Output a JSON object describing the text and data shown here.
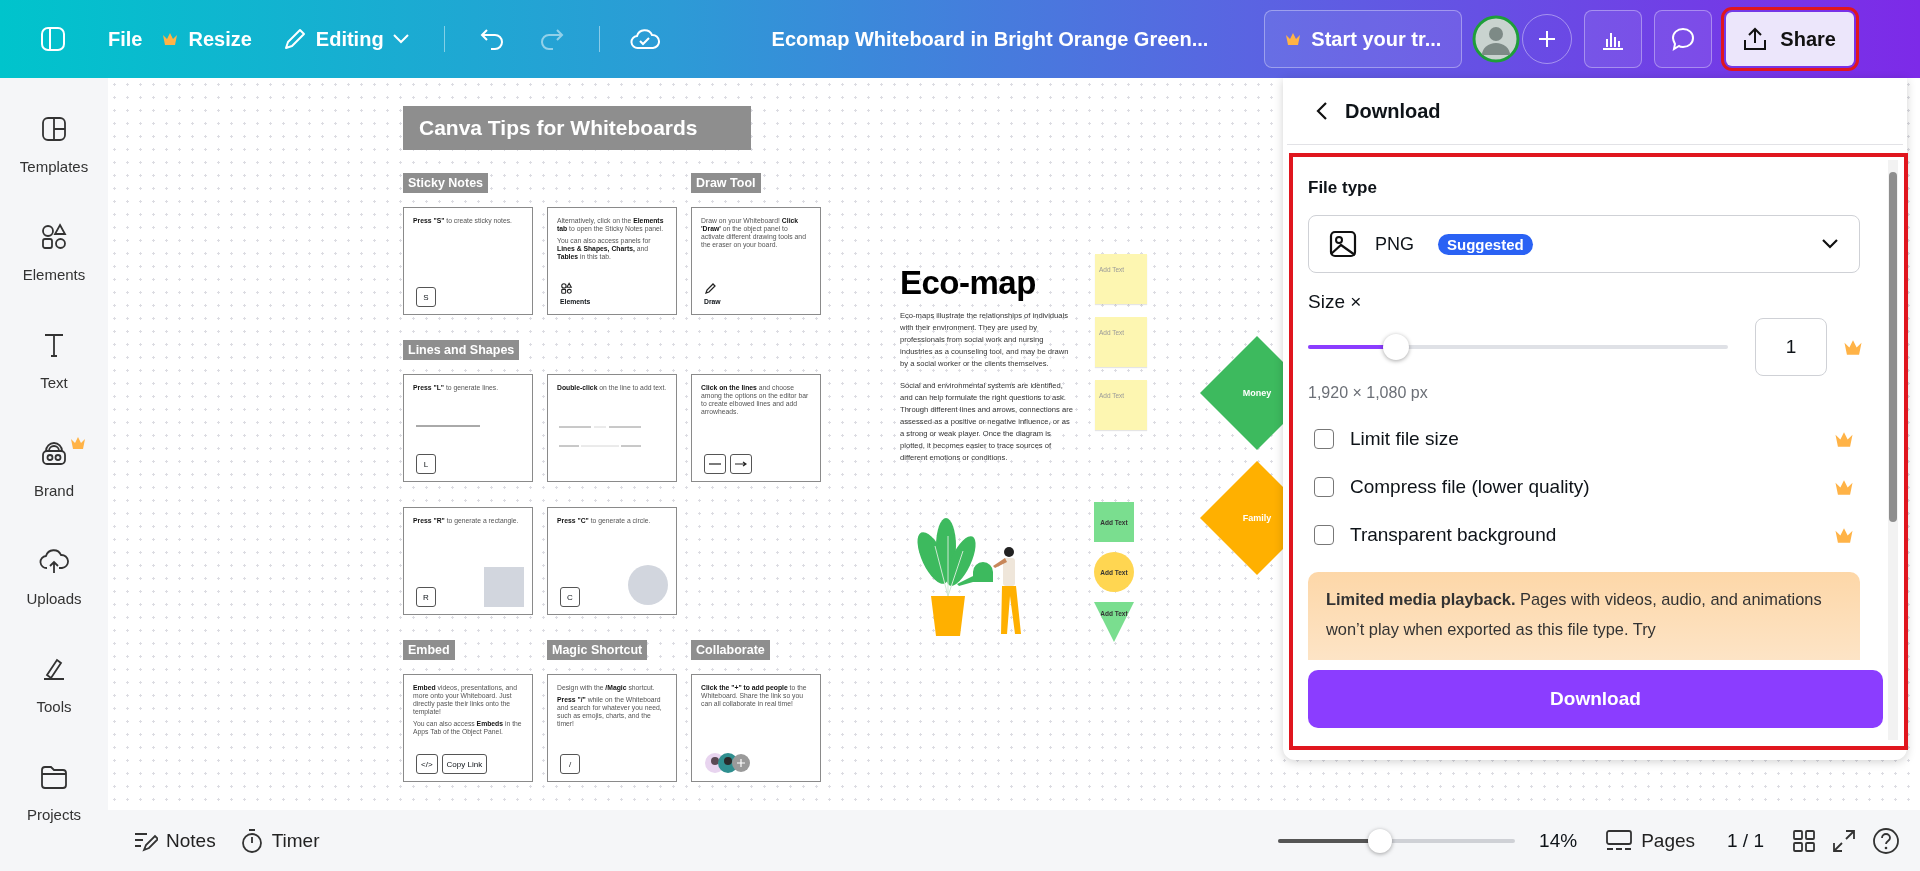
{
  "topbar": {
    "file": "File",
    "resize": "Resize",
    "mode": "Editing",
    "title": "Ecomap Whiteboard in Bright Orange Green...",
    "trial": "Start your tr...",
    "share": {
      "label": "Share",
      "highlighted": true
    }
  },
  "sidebar": [
    {
      "label": "Templates",
      "premium": false
    },
    {
      "label": "Elements",
      "premium": false
    },
    {
      "label": "Text",
      "premium": false
    },
    {
      "label": "Brand",
      "premium": true
    },
    {
      "label": "Uploads",
      "premium": false
    },
    {
      "label": "Tools",
      "premium": false
    },
    {
      "label": "Projects",
      "premium": false
    }
  ],
  "board": {
    "title": "Canva Tips for Whiteboards",
    "rows": [
      {
        "cards": [
          {
            "heading": "Sticky Notes",
            "kind": "keys",
            "paragraphs": [
              "**Press \"S\"** to create sticky notes."
            ],
            "keys": [
              "S"
            ]
          },
          {
            "kind": "elements",
            "paragraphs": [
              "Alternatively, click on the **Elements tab** to open the Sticky Notes panel.",
              "You can also access panels for **Lines & Shapes, Charts,** and **Tables** in this tab."
            ],
            "caption": "Elements"
          },
          {
            "heading": "Draw Tool",
            "kind": "draw",
            "paragraphs": [
              "Draw on your Whiteboard! **Click 'Draw'** on the object panel to activate different drawing tools and the eraser on your board."
            ],
            "caption": "Draw"
          }
        ]
      },
      {
        "cards": [
          {
            "heading": "Lines and Shapes",
            "kind": "line",
            "paragraphs": [
              "**Press \"L\"** to generate lines."
            ],
            "keys": [
              "L"
            ]
          },
          {
            "kind": "double-line",
            "paragraphs": [
              "**Double-click** on the line to add text."
            ]
          },
          {
            "kind": "arrows",
            "paragraphs": [
              "**Click on the lines** and choose among the options on the editor bar to create elbowed lines and add arrowheads."
            ]
          }
        ]
      },
      {
        "cards": [
          {
            "kind": "rect",
            "paragraphs": [
              "**Press \"R\"** to generate a rectangle."
            ],
            "keys": [
              "R"
            ]
          },
          {
            "kind": "circle",
            "paragraphs": [
              "**Press \"C\"** to generate a circle."
            ],
            "keys": [
              "C"
            ]
          }
        ]
      },
      {
        "cards": [
          {
            "heading": "Embed",
            "kind": "keys",
            "paragraphs": [
              "**Embed** videos, presentations, and more onto your Whiteboard. Just directly paste their links onto the template!",
              "You can also access **Embeds** in the Apps Tab of the Object Panel."
            ],
            "keys": [
              "</>",
              "Copy Link"
            ]
          },
          {
            "heading": "Magic Shortcut",
            "kind": "keys",
            "paragraphs": [
              "Design with the **/Magic** shortcut.",
              "**Press \"/\"** while on the Whiteboard and search for whatever you need, such as emojis, charts, and the timer!"
            ],
            "keys": [
              "/"
            ]
          },
          {
            "heading": "Collaborate",
            "kind": "avatars",
            "paragraphs": [
              "**Click the \"+\" to add people** to the Whiteboard. Share the link so you can all collaborate in real time!"
            ]
          }
        ]
      }
    ]
  },
  "ecomap": {
    "title": "Eco-map",
    "paragraphs": [
      "Eco-maps illustrate the relationships of individuals with their environment. They are used by professionals from social work and nursing industries as a counseling tool, and may be drawn by a social worker or the clients themselves.",
      "Social and environmental systems are identified, and can help formulate the right questions to ask. Through different lines and arrows, connections are assessed as a positive or negative influence, or as a strong or weak player. Once the diagram is plotted, it becomes easier to trace sources of different emotions or conditions."
    ],
    "sticky_notes": [
      {
        "text": "Add Text"
      },
      {
        "text": "Add Text"
      },
      {
        "text": "Add Text"
      }
    ],
    "shapes": [
      {
        "kind": "square",
        "text": "Add Text"
      },
      {
        "kind": "circle",
        "text": "Add Text"
      },
      {
        "kind": "triangle",
        "text": "Add Text"
      }
    ],
    "nodes": [
      {
        "label": "Money",
        "color": "#3dba5e"
      },
      {
        "label": "Family",
        "color": "#ffb000"
      }
    ]
  },
  "panel": {
    "title": "Download",
    "highlighted": true,
    "file_type_label": "File type",
    "file_type": "PNG",
    "badge": "Suggested",
    "size_label": "Size ×",
    "size": {
      "level": 0.21,
      "value": "1"
    },
    "dimensions": "1,920 × 1,080 px",
    "options": [
      {
        "label": "Limit file size",
        "checked": false,
        "premium": true
      },
      {
        "label": "Compress file (lower quality)",
        "checked": false,
        "premium": true
      },
      {
        "label": "Transparent background",
        "checked": false,
        "premium": true
      }
    ],
    "notice": "**Limited media playback.** Pages with videos, audio, and animations won’t play when exported as this file type. Try",
    "button": "Download"
  },
  "bottombar": {
    "notes": "Notes",
    "timer": "Timer",
    "zoom": {
      "level": 0.43,
      "reading": "14%"
    },
    "pages": "Pages",
    "page_count": "1 / 1"
  }
}
